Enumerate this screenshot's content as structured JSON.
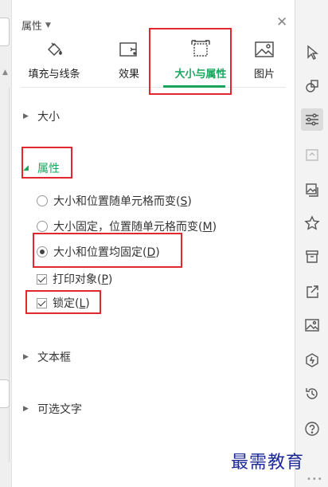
{
  "panel": {
    "title": "属性",
    "tabs": [
      {
        "label": "填充与线条",
        "icon": "paint-bucket-icon"
      },
      {
        "label": "效果",
        "icon": "effects-icon"
      },
      {
        "label": "大小与属性",
        "icon": "size-properties-icon",
        "active": true
      },
      {
        "label": "图片",
        "icon": "picture-icon"
      }
    ],
    "sections": {
      "size": "大小",
      "properties": "属性",
      "textbox": "文本框",
      "alt_text": "可选文字"
    },
    "options": {
      "move_size_with_cells": {
        "text": "大小和位置随单元格而变(",
        "key": "S",
        "suffix": ")"
      },
      "move_not_size": {
        "text": "大小固定，位置随单元格而变(",
        "key": "M",
        "suffix": ")"
      },
      "fixed": {
        "text": "大小和位置均固定(",
        "key": "D",
        "suffix": ")",
        "selected": true
      },
      "print_object": {
        "text": "打印对象(",
        "key": "P",
        "suffix": ")",
        "checked": true
      },
      "locked": {
        "text": "锁定(",
        "key": "L",
        "suffix": ")",
        "checked": true
      }
    }
  },
  "colors": {
    "accent": "#1aa55d",
    "highlight": "#e0282e",
    "watermark": "#1e2a9a"
  },
  "toolbar_icons": [
    "pointer-icon",
    "shapes-icon",
    "settings-sliders-icon",
    "undo-disabled-icon",
    "image-gallery-icon",
    "star-icon",
    "archive-box-icon",
    "share-icon",
    "image-icon",
    "shield-badge-icon",
    "history-icon",
    "help-icon"
  ],
  "watermark": "最需教育"
}
